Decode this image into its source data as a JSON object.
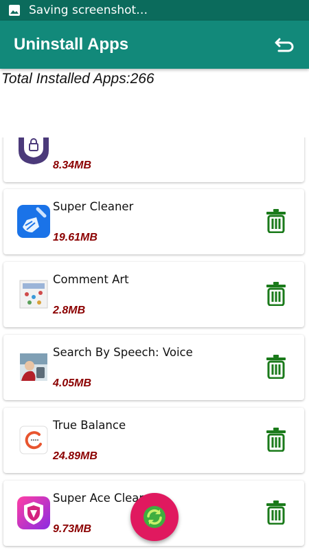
{
  "status_bar": {
    "text": "Saving screenshot…",
    "icon": "image-icon"
  },
  "app_bar": {
    "title": "Uninstall Apps",
    "back_icon": "undo-arrow-icon"
  },
  "summary": {
    "total_label": "Total Installed Apps:266"
  },
  "apps": [
    {
      "name": "",
      "size": "8.34MB",
      "icon": "app-lock-icon"
    },
    {
      "name": "Super Cleaner",
      "size": "19.61MB",
      "icon": "broom-icon"
    },
    {
      "name": "Comment Art",
      "size": "2.8MB",
      "icon": "comment-art-icon"
    },
    {
      "name": "Search By Speech: Voice",
      "size": "4.05MB",
      "icon": "voice-search-icon"
    },
    {
      "name": "True Balance",
      "size": "24.89MB",
      "icon": "true-balance-icon"
    },
    {
      "name": "Super Ace Cleaner",
      "size": "9.73MB",
      "icon": "shield-cleaner-icon"
    }
  ],
  "actions": {
    "delete_icon": "trash-icon",
    "refresh_icon": "refresh-icon"
  },
  "colors": {
    "status_bar": "#0b6b5c",
    "app_bar": "#12897a",
    "size_text": "#8b0000",
    "delete": "#1a7a1a",
    "fab": "#e0195f"
  }
}
